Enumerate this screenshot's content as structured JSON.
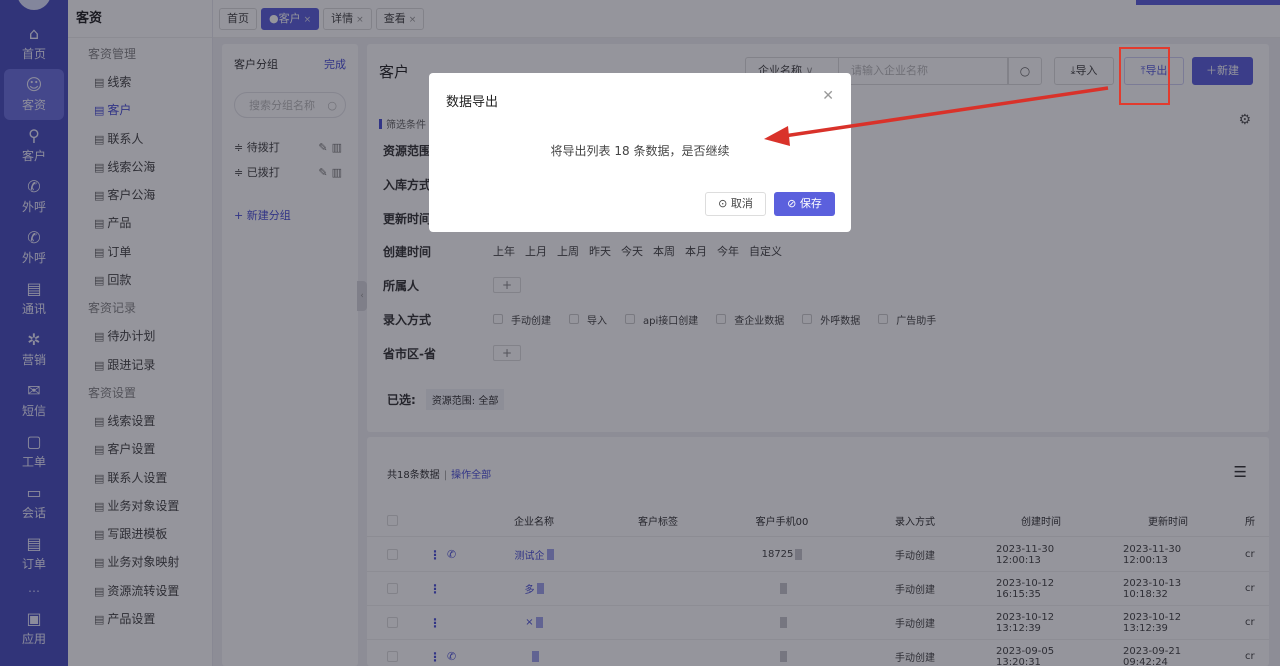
{
  "rail": {
    "items": [
      {
        "label": "首页",
        "icon": "home-icon",
        "glyph": "⌂"
      },
      {
        "label": "客资",
        "icon": "people-icon",
        "glyph": "☺"
      },
      {
        "label": "客户",
        "icon": "person-icon",
        "glyph": "⚲"
      },
      {
        "label": "外呼",
        "icon": "phone-icon",
        "glyph": "✆"
      },
      {
        "label": "外呼",
        "icon": "phone-icon",
        "glyph": "✆"
      },
      {
        "label": "通讯",
        "icon": "contacts-icon",
        "glyph": "▤"
      },
      {
        "label": "营销",
        "icon": "gear-icon",
        "glyph": "✲"
      },
      {
        "label": "短信",
        "icon": "message-icon",
        "glyph": "✉"
      },
      {
        "label": "工单",
        "icon": "clipboard-icon",
        "glyph": "▢"
      },
      {
        "label": "会话",
        "icon": "chat-icon",
        "glyph": "▭"
      },
      {
        "label": "订单",
        "icon": "order-icon",
        "glyph": "▤"
      }
    ],
    "separator": "⋯",
    "bottom": {
      "label": "应用",
      "icon": "app-icon",
      "glyph": "▣"
    }
  },
  "menu": {
    "title": "客资",
    "groups": [
      {
        "label": "客资管理",
        "items": [
          "线索",
          "客户",
          "联系人",
          "线索公海",
          "客户公海",
          "产品",
          "订单",
          "回款"
        ]
      },
      {
        "label": "客资记录",
        "items": [
          "待办计划",
          "跟进记录"
        ]
      },
      {
        "label": "客资设置",
        "items": [
          "线索设置",
          "客户设置",
          "联系人设置",
          "业务对象设置",
          "写跟进模板",
          "业务对象映射",
          "资源流转设置",
          "产品设置"
        ]
      }
    ],
    "active_item": "客户"
  },
  "tabs": [
    {
      "label": "首页",
      "closable": false,
      "active": false
    },
    {
      "label": "●客户",
      "closable": true,
      "active": true
    },
    {
      "label": "详情",
      "closable": true,
      "active": false
    },
    {
      "label": "查看",
      "closable": true,
      "active": false
    }
  ],
  "groups_panel": {
    "title": "客户分组",
    "done": "完成",
    "search_placeholder": "搜索分组名称",
    "groups": [
      "待拨打",
      "已拨打"
    ],
    "new_group": "+ 新建分组"
  },
  "main": {
    "title": "客户",
    "search_field": "企业名称",
    "search_placeholder": "请输入企业名称",
    "import_label": "导入",
    "export_label": "导出",
    "new_label": "新建",
    "filter_title": "筛选条件",
    "filters": {
      "scope_label": "资源范围",
      "storage_label": "入库方式",
      "updated_label": "更新时间",
      "created_label": "创建时间",
      "created_options": [
        "上年",
        "上月",
        "上周",
        "昨天",
        "今天",
        "本周",
        "本月",
        "今年",
        "自定义"
      ],
      "owner_label": "所属人",
      "entry_label": "录入方式",
      "entry_options": [
        "手动创建",
        "导入",
        "api接口创建",
        "查企业数据",
        "外呼数据",
        "广告助手"
      ],
      "region_label": "省市区-省"
    },
    "selected_label": "已选:",
    "selected_chip": "资源范围: 全部"
  },
  "table": {
    "summary": "共18条数据",
    "summary_sep": "|",
    "operate_all": "操作全部",
    "columns": [
      "企业名称",
      "客户标签",
      "客户手机00",
      "录入方式",
      "创建时间",
      "更新时间",
      "所"
    ],
    "rows": [
      {
        "name": "测试企",
        "phone": "18725",
        "entry": "手动创建",
        "created": "2023-11-30 12:00:13",
        "updated": "2023-11-30 12:00:13",
        "owner": "cr"
      },
      {
        "name": "多",
        "phone": "",
        "entry": "手动创建",
        "created": "2023-10-12 16:15:35",
        "updated": "2023-10-13 10:18:32",
        "owner": "cr"
      },
      {
        "name": "×",
        "phone": "",
        "entry": "手动创建",
        "created": "2023-10-12 13:12:39",
        "updated": "2023-10-12 13:12:39",
        "owner": "cr"
      },
      {
        "name": "",
        "phone": "",
        "entry": "手动创建",
        "created": "2023-09-05 13:20:31",
        "updated": "2023-09-21 09:42:24",
        "owner": "cr"
      }
    ]
  },
  "modal": {
    "title": "数据导出",
    "message": "将导出列表 18 条数据，是否继续",
    "cancel": "取消",
    "save": "保存"
  },
  "colors": {
    "accent": "#5b60dd",
    "rail": "#4a4fbf",
    "annotation": "#e23b2e"
  }
}
